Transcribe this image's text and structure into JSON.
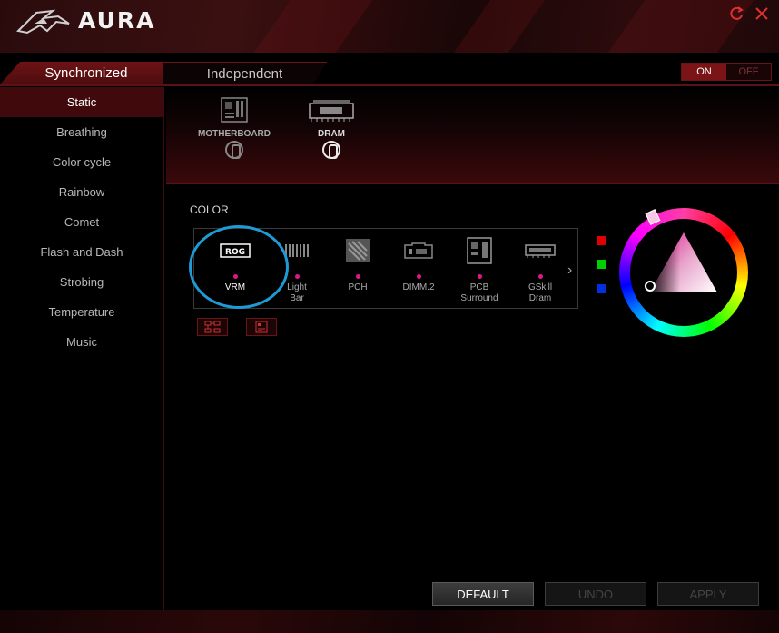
{
  "app": {
    "title": "AURA"
  },
  "window": {
    "refresh_icon": "refresh-icon",
    "close_icon": "close-icon"
  },
  "tabs": [
    {
      "label": "Synchronized",
      "active": true
    },
    {
      "label": "Independent",
      "active": false
    }
  ],
  "power_toggle": {
    "on_label": "ON",
    "off_label": "OFF",
    "value": "ON"
  },
  "sidebar": {
    "items": [
      {
        "label": "Static",
        "active": true
      },
      {
        "label": "Breathing"
      },
      {
        "label": "Color cycle"
      },
      {
        "label": "Rainbow"
      },
      {
        "label": "Comet"
      },
      {
        "label": "Flash and Dash"
      },
      {
        "label": "Strobing"
      },
      {
        "label": "Temperature"
      },
      {
        "label": "Music"
      }
    ]
  },
  "devices": [
    {
      "label": "MOTHERBOARD",
      "icon": "motherboard-icon",
      "synced": false
    },
    {
      "label": "DRAM",
      "icon": "dram-icon",
      "synced": true
    }
  ],
  "color_section": {
    "label": "COLOR"
  },
  "zones": [
    {
      "label": "VRM",
      "label2": "",
      "icon": "rog-icon",
      "selected": true
    },
    {
      "label": "Light",
      "label2": "Bar",
      "icon": "light-bar-icon"
    },
    {
      "label": "PCH",
      "label2": "",
      "icon": "pch-icon"
    },
    {
      "label": "DIMM.2",
      "label2": "",
      "icon": "dimm2-icon"
    },
    {
      "label": "PCB",
      "label2": "Surround",
      "icon": "pcb-icon"
    },
    {
      "label": "GSkill",
      "label2": "Dram",
      "icon": "gskill-dram-icon"
    }
  ],
  "swatches": {
    "red": "#e00000",
    "green": "#00d000",
    "blue": "#0030e0"
  },
  "selected_color": "#e1168c",
  "actions": {
    "default_label": "DEFAULT",
    "undo_label": "UNDO",
    "apply_label": "APPLY"
  }
}
